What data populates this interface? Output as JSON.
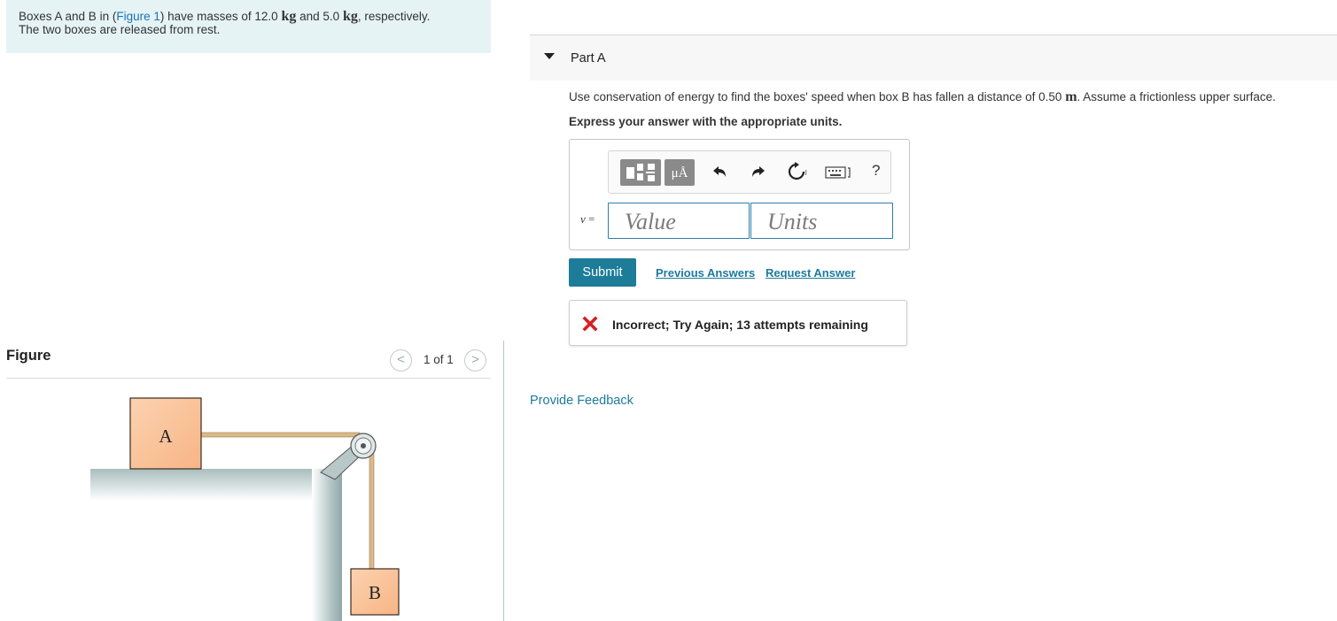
{
  "intro": {
    "line1_a": "Boxes A and B in (",
    "figure_link": "Figure 1",
    "line1_b": ") have masses of 12.0",
    "unit_kg": "kg",
    "line1_c": "and 5.0",
    "unit_kg2": "kg",
    "line1_d": ", respectively.",
    "line2": "The two boxes are released from rest."
  },
  "figure": {
    "title": "Figure",
    "pager": {
      "count": "1 of 1",
      "prev": "<",
      "next": ">"
    },
    "box_a_label": "A",
    "box_b_label": "B"
  },
  "part": {
    "title": "Part A",
    "question_a": "Use conservation of energy to find the boxes' speed when box B has fallen a distance of 0.50",
    "question_unit": "m",
    "question_b": ". Assume a frictionless upper surface.",
    "instruction": "Express your answer with the appropriate units."
  },
  "answer": {
    "toolbar": {
      "units_label": "μÅ",
      "help_label": "?"
    },
    "variable": "v",
    "equals": "=",
    "value_placeholder": "Value",
    "units_placeholder": "Units"
  },
  "actions": {
    "submit_label": "Submit",
    "previous_answers": "Previous Answers",
    "request_answer": "Request Answer"
  },
  "feedback": {
    "message": "Incorrect; Try Again; 13 attempts remaining",
    "provide_feedback": "Provide Feedback"
  },
  "colors": {
    "accent": "#1d7c98",
    "link": "#1d7a9c",
    "error": "#d81e1e",
    "intro_bg": "#e5f3f5",
    "box_fill": "#f9c59f"
  }
}
